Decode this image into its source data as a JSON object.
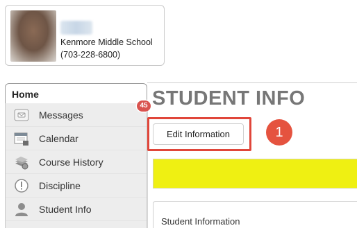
{
  "profile": {
    "school_name": "Kenmore Middle School",
    "school_phone": "(703-228-6800)"
  },
  "sidebar": {
    "home_label": "Home",
    "items": [
      {
        "label": "Messages",
        "icon": "messages-icon",
        "badge": "45"
      },
      {
        "label": "Calendar",
        "icon": "calendar-icon"
      },
      {
        "label": "Course History",
        "icon": "course-history-icon"
      },
      {
        "label": "Discipline",
        "icon": "discipline-icon"
      },
      {
        "label": "Student Info",
        "icon": "student-info-icon"
      }
    ]
  },
  "main": {
    "title": "STUDENT INFO",
    "edit_button_label": "Edit Information",
    "step_number": "1",
    "panel_title": "Student Information"
  },
  "colors": {
    "highlight": "#e0463a",
    "badge": "#d9534f",
    "banner": "#eff012",
    "step_circle": "#e5533f"
  }
}
